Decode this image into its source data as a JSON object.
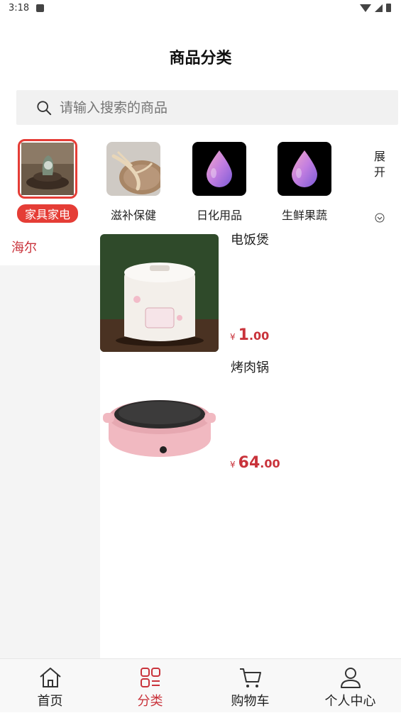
{
  "status_bar": {
    "time": "3:18"
  },
  "header": {
    "title": "商品分类"
  },
  "search": {
    "placeholder": "请输入搜索的商品"
  },
  "categories": [
    {
      "label": "家具家电",
      "active": true,
      "icon": "teapot-photo"
    },
    {
      "label": "滋补保健",
      "active": false,
      "icon": "ginseng-photo"
    },
    {
      "label": "日化用品",
      "active": false,
      "icon": "droplet-icon"
    },
    {
      "label": "生鲜果蔬",
      "active": false,
      "icon": "droplet-icon"
    }
  ],
  "expand": {
    "label": "展开"
  },
  "sidebar": {
    "items": [
      {
        "label": "海尔",
        "active": true
      }
    ]
  },
  "products": [
    {
      "name": "电饭煲",
      "currency": "¥",
      "price_int": "1",
      "price_dec": ".00",
      "image": "rice-cooker-photo"
    },
    {
      "name": "烤肉锅",
      "currency": "¥",
      "price_int": "64",
      "price_dec": ".00",
      "image": "grill-pan-photo"
    }
  ],
  "tabbar": {
    "tabs": [
      {
        "label": "首页",
        "icon": "home-icon",
        "active": false
      },
      {
        "label": "分类",
        "icon": "category-icon",
        "active": true
      },
      {
        "label": "购物车",
        "icon": "cart-icon",
        "active": false
      },
      {
        "label": "个人中心",
        "icon": "user-icon",
        "active": false
      }
    ]
  },
  "colors": {
    "accent": "#c9333b",
    "active_badge": "#e53d36",
    "search_bg": "#f1f1f1",
    "sidebar_bg": "#f4f4f4"
  }
}
